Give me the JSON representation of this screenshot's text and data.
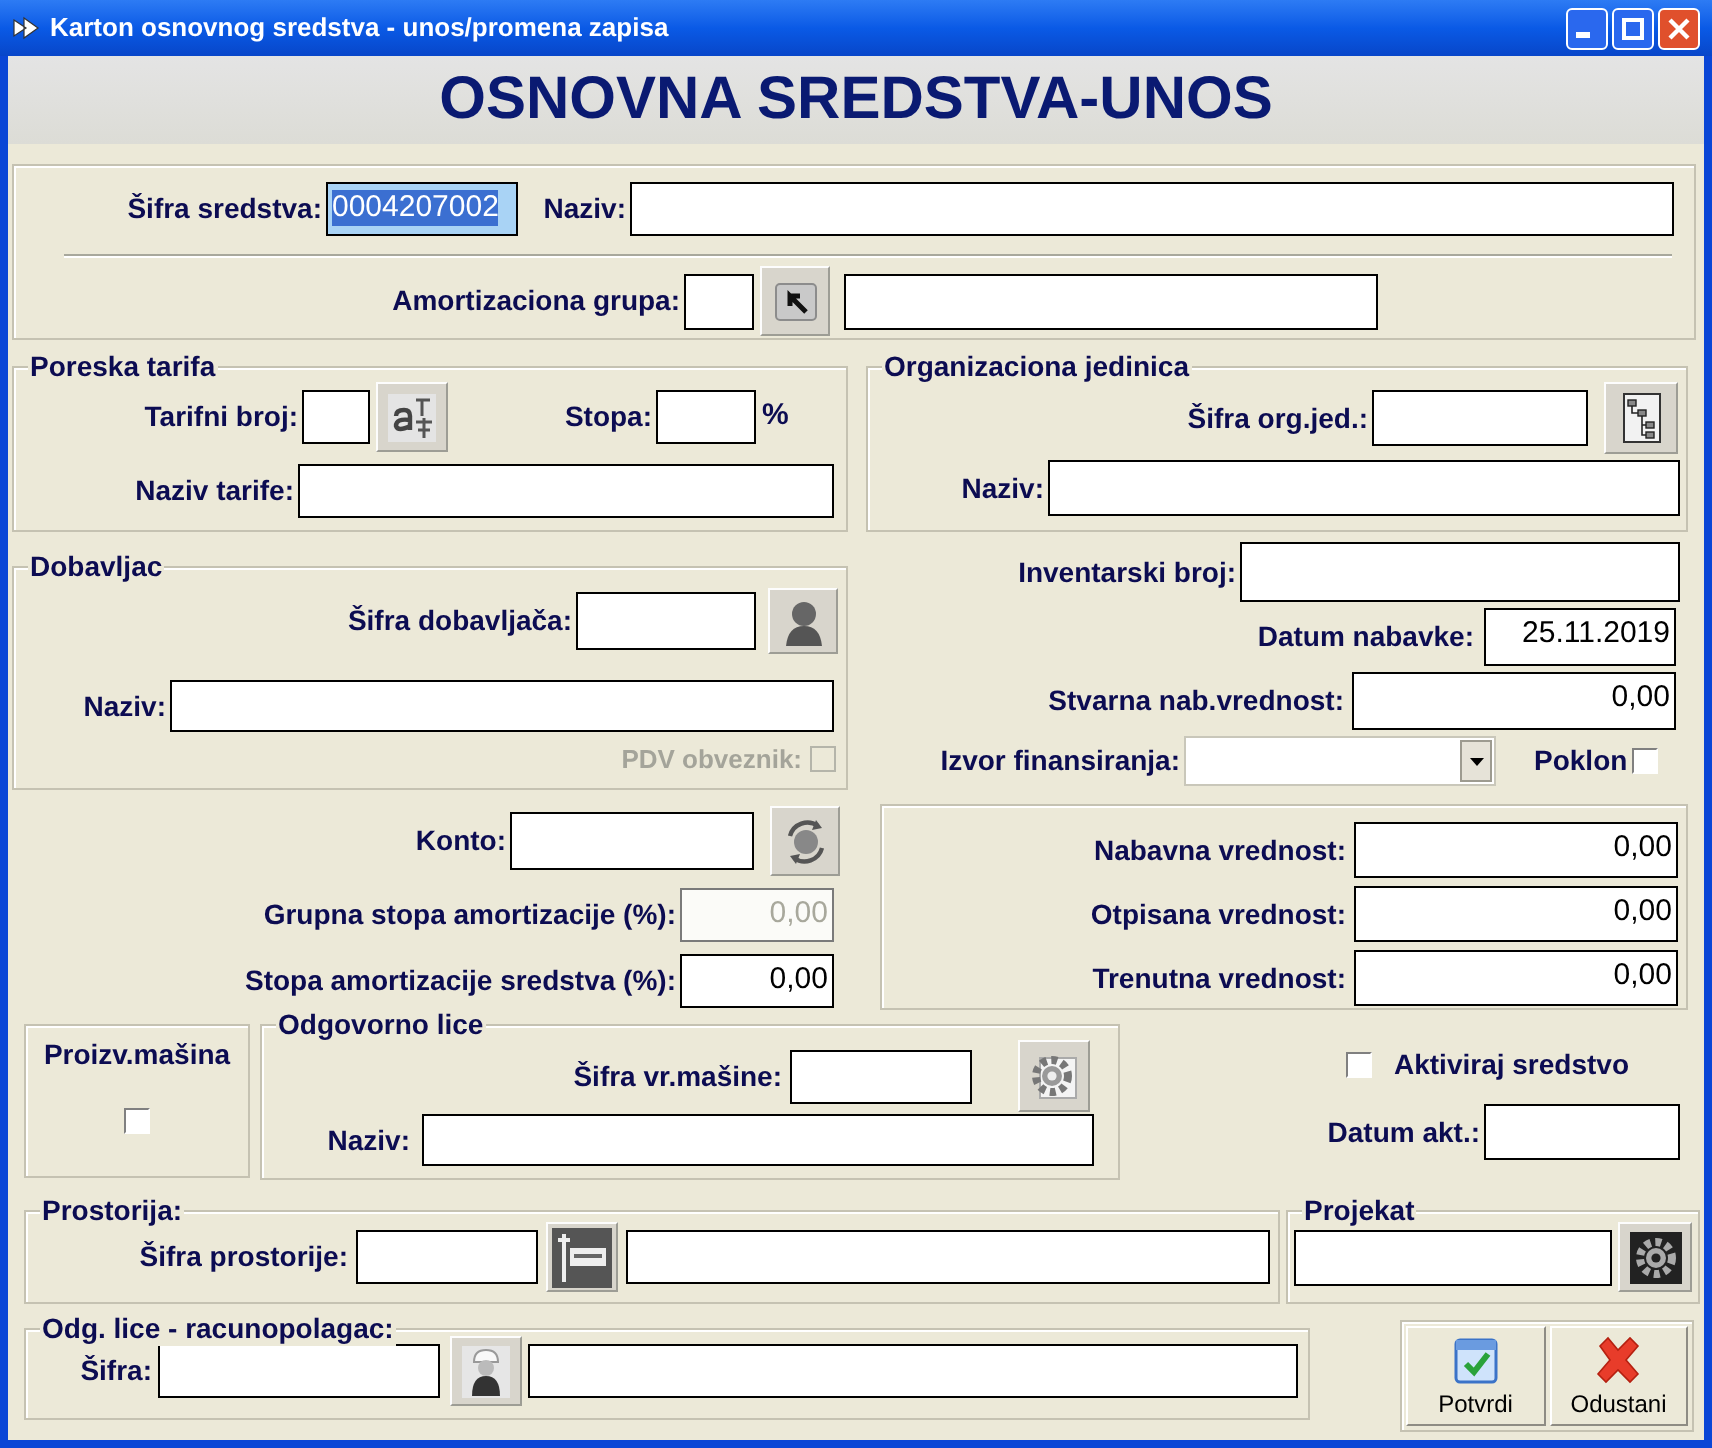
{
  "window": {
    "title": "Karton osnovnog sredstva - unos/promena zapisa"
  },
  "heading": "OSNOVNA SREDSTVA-UNOS",
  "asset": {
    "code_label": "Šifra sredstva:",
    "code": {
      "value": "0004207002",
      "selected": true
    },
    "name_label": "Naziv:",
    "group_label": "Amortizaciona grupa:"
  },
  "tax": {
    "title": "Poreska tarifa",
    "number_label": "Tarifni broj:",
    "rate_label": "Stopa:",
    "percent_sign": "%",
    "name_label": "Naziv tarife:"
  },
  "org_unit": {
    "title": "Organizaciona jedinica",
    "code_label": "Šifra org.jed.:",
    "name_label": "Naziv:"
  },
  "supplier": {
    "title": "Dobavljac",
    "code_label": "Šifra dobavljača:",
    "name_label": "Naziv:",
    "vat_payer": {
      "label": "PDV obveznik:",
      "checked": false,
      "disabled": true
    }
  },
  "inventory_number_label": "Inventarski broj:",
  "purchase_date": {
    "label": "Datum nabavke:",
    "value": "25.11.2019"
  },
  "actual_purchase_value": {
    "label": "Stvarna nab.vrednost:",
    "value": "0,00"
  },
  "funding_source_label": "Izvor finansiranja:",
  "gift": {
    "label": "Poklon",
    "checked": false
  },
  "account_label": "Konto:",
  "group_rate": {
    "label": "Grupna stopa amortizacije (%):",
    "value": "0,00",
    "disabled": true
  },
  "asset_rate": {
    "label": "Stopa amortizacije sredstva (%):",
    "value": "0,00"
  },
  "values": [
    {
      "label": "Nabavna vrednost:",
      "value": "0,00"
    },
    {
      "label": "Otpisana vrednost:",
      "value": "0,00"
    },
    {
      "label": "Trenutna vrednost:",
      "value": "0,00"
    }
  ],
  "production_machine": {
    "label": "Proizv.mašina",
    "checked": false
  },
  "responsible_person": {
    "title": "Odgovorno lice",
    "code_label": "Šifra vr.mašine:",
    "name_label": "Naziv:"
  },
  "activate": {
    "label": "Aktiviraj sredstvo",
    "checked": false
  },
  "activation_date_label": "Datum akt.:",
  "room": {
    "title": "Prostorija:",
    "code_label": "Šifra prostorije:"
  },
  "project": {
    "title": "Projekat"
  },
  "accountable_person": {
    "title": "Odg. lice - racunopolagac:",
    "code_label": "Šifra:"
  },
  "buttons": [
    {
      "label": "Potvrdi",
      "kind": "confirm"
    },
    {
      "label": "Odustani",
      "kind": "cancel"
    }
  ]
}
